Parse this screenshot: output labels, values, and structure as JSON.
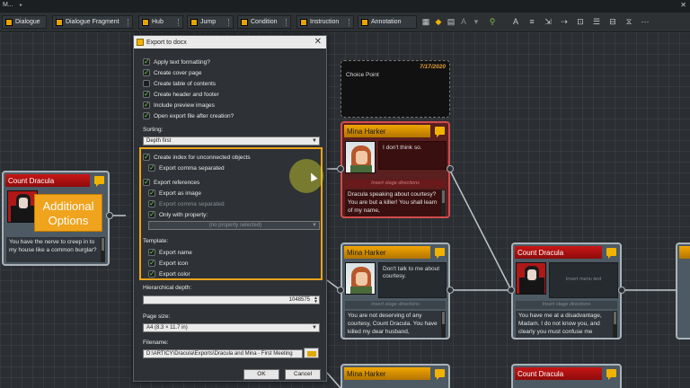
{
  "window": {
    "title": "M...",
    "menu_caret": "▸"
  },
  "toolbar": {
    "items": [
      "Dialogue",
      "Dialogue Fragment",
      "Hub",
      "Jump",
      "Condition",
      "Instruction",
      "Annotation"
    ]
  },
  "choice_point": {
    "date": "7/17/2020",
    "label": "Choice Point"
  },
  "nodes": {
    "count_left": {
      "speaker": "Count Dracula",
      "text": "You have the nerve to creep in to my house like a common burglar?"
    },
    "mina_top": {
      "speaker": "Mina Harker",
      "speech": "I don't think so.",
      "stage": "Insert stage directions",
      "text": "Dracula speaking about courtesy? You are but a killer! You shall learn of my name,"
    },
    "mina_mid": {
      "speaker": "Mina Harker",
      "speech": "Don't talk to me about courtesy.",
      "stage": "Insert stage directions",
      "text": "You are not deserving of any courtesy, Count Dracula. You have killed my dear husband,"
    },
    "count_right": {
      "speaker": "Count Dracula",
      "speech": "Insert menu text",
      "stage": "Insert stage directions",
      "text": "You have me at a disadvantage, Madam. I do not know you, and clearly you must confuse me"
    },
    "mina_bottom": {
      "speaker": "Mina Harker"
    },
    "count_bottom": {
      "speaker": "Count Dracula"
    }
  },
  "overlay": {
    "line1": "Additional",
    "line2": "Options"
  },
  "dialog": {
    "title": "Export to docx",
    "options": [
      {
        "label": "Apply text formatting?",
        "checked": true
      },
      {
        "label": "Create cover page",
        "checked": true
      },
      {
        "label": "Create table of contents",
        "checked": false
      },
      {
        "label": "Create header and footer",
        "checked": true
      },
      {
        "label": "Include preview images",
        "checked": true
      },
      {
        "label": "Open export file after creation?",
        "checked": true
      }
    ],
    "sorting_label": "Sorting:",
    "sorting_value": "Depth first",
    "index_label": "Create index for unconnected objects",
    "index_comma": "Export comma separated",
    "refs_label": "Export references",
    "refs_image": "Export as image",
    "refs_comma": "Export comma separated",
    "refs_only": "Only with property:",
    "property_placeholder": "(no property selected)",
    "template_label": "Template:",
    "template_name": "Export name",
    "template_icon": "Export icon",
    "template_color": "Export color",
    "depth_label": "Hierarchical depth:",
    "depth_value": "1048575",
    "page_size_label": "Page size:",
    "page_size_value": "A4 (8.3 × 11.7 in)",
    "filename_label": "Filename:",
    "filename_value": "D:\\ARTICY\\Dracula\\Exports\\Dracula and Mina - First Meeting",
    "ok": "OK",
    "cancel": "Cancel"
  }
}
